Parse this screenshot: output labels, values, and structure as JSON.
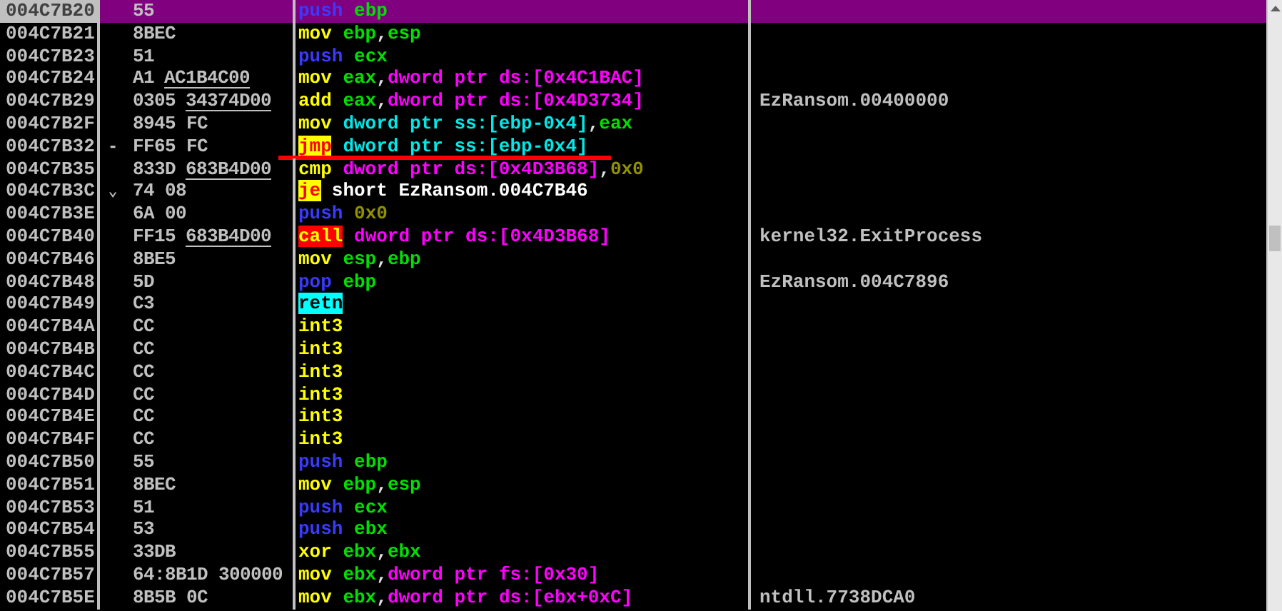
{
  "rows": [
    {
      "address": "004C7B20",
      "selected": true,
      "bytes": [
        {
          "text": "55",
          "fixup": false
        }
      ],
      "tokens": [
        {
          "text": "push",
          "kind": "push"
        },
        {
          "text": " ebp",
          "kind": "reg"
        }
      ],
      "comment": ""
    },
    {
      "address": "004C7B21",
      "selected": false,
      "bytes": [
        {
          "text": "8BEC",
          "fixup": false
        }
      ],
      "tokens": [
        {
          "text": "mov",
          "kind": "op"
        },
        {
          "text": " ebp",
          "kind": "reg"
        },
        {
          "text": ",",
          "kind": "punct"
        },
        {
          "text": "esp",
          "kind": "reg"
        }
      ]
    },
    {
      "address": "004C7B23",
      "selected": false,
      "bytes": [
        {
          "text": "51",
          "fixup": false
        }
      ],
      "tokens": [
        {
          "text": "push",
          "kind": "push"
        },
        {
          "text": " ecx",
          "kind": "reg"
        }
      ]
    },
    {
      "address": "004C7B24",
      "selected": false,
      "bytes": [
        {
          "text": "A1",
          "fixup": false
        },
        {
          "text": "AC1B4C00",
          "fixup": true
        }
      ],
      "tokens": [
        {
          "text": "mov",
          "kind": "op"
        },
        {
          "text": " eax",
          "kind": "reg"
        },
        {
          "text": ",",
          "kind": "punct"
        },
        {
          "text": "dword ptr ds:[0x4C1BAC]",
          "kind": "mem"
        }
      ]
    },
    {
      "address": "004C7B29",
      "selected": false,
      "bytes": [
        {
          "text": "0305",
          "fixup": false
        },
        {
          "text": "34374D00",
          "fixup": true
        }
      ],
      "tokens": [
        {
          "text": "add",
          "kind": "op"
        },
        {
          "text": " eax",
          "kind": "reg"
        },
        {
          "text": ",",
          "kind": "punct"
        },
        {
          "text": "dword ptr ds:[0x4D3734]",
          "kind": "mem"
        }
      ],
      "comment": "EzRansom.00400000"
    },
    {
      "address": "004C7B2F",
      "selected": false,
      "bytes": [
        {
          "text": "8945 FC",
          "fixup": false
        }
      ],
      "tokens": [
        {
          "text": "mov",
          "kind": "op"
        },
        {
          "text": " dword ptr ss:[ebp-0x4]",
          "kind": "stack"
        },
        {
          "text": ",",
          "kind": "punct"
        },
        {
          "text": "eax",
          "kind": "reg"
        }
      ]
    },
    {
      "address": "004C7B32",
      "selected": false,
      "jump_mark": "-",
      "marked": true,
      "bytes": [
        {
          "text": "FF65 FC",
          "fixup": false
        }
      ],
      "tokens": [
        {
          "text": "jmp",
          "kind": "jmp"
        },
        {
          "text": " dword ptr ss:[ebp-0x4]",
          "kind": "stack"
        }
      ]
    },
    {
      "address": "004C7B35",
      "selected": false,
      "bytes": [
        {
          "text": "833D",
          "fixup": false
        },
        {
          "text": "683B4D00",
          "fixup": true
        }
      ],
      "tokens": [
        {
          "text": "cmp",
          "kind": "op"
        },
        {
          "text": " dword ptr ds:[0x4D3B68]",
          "kind": "mem"
        },
        {
          "text": ",",
          "kind": "punct"
        },
        {
          "text": "0x0",
          "kind": "imm"
        }
      ]
    },
    {
      "address": "004C7B3C",
      "selected": false,
      "jump_mark": "⌄",
      "bytes": [
        {
          "text": "74 08",
          "fixup": false
        }
      ],
      "tokens": [
        {
          "text": "je",
          "kind": "jmp"
        },
        {
          "text": " short EzRansom.004C7B46",
          "kind": "plain"
        }
      ]
    },
    {
      "address": "004C7B3E",
      "selected": false,
      "bytes": [
        {
          "text": "6A 00",
          "fixup": false
        }
      ],
      "tokens": [
        {
          "text": "push",
          "kind": "push"
        },
        {
          "text": " 0x0",
          "kind": "imm"
        }
      ]
    },
    {
      "address": "004C7B40",
      "selected": false,
      "bytes": [
        {
          "text": "FF15",
          "fixup": false
        },
        {
          "text": "683B4D00",
          "fixup": true
        }
      ],
      "tokens": [
        {
          "text": "call",
          "kind": "call"
        },
        {
          "text": " dword ptr ds:[0x4D3B68]",
          "kind": "mem"
        }
      ],
      "comment": "kernel32.ExitProcess"
    },
    {
      "address": "004C7B46",
      "selected": false,
      "bytes": [
        {
          "text": "8BE5",
          "fixup": false
        }
      ],
      "tokens": [
        {
          "text": "mov",
          "kind": "op"
        },
        {
          "text": " esp",
          "kind": "reg"
        },
        {
          "text": ",",
          "kind": "punct"
        },
        {
          "text": "ebp",
          "kind": "reg"
        }
      ]
    },
    {
      "address": "004C7B48",
      "selected": false,
      "bytes": [
        {
          "text": "5D",
          "fixup": false
        }
      ],
      "tokens": [
        {
          "text": "pop",
          "kind": "push"
        },
        {
          "text": " ebp",
          "kind": "reg"
        }
      ],
      "comment": "EzRansom.004C7896"
    },
    {
      "address": "004C7B49",
      "selected": false,
      "bytes": [
        {
          "text": "C3",
          "fixup": false
        }
      ],
      "tokens": [
        {
          "text": "retn",
          "kind": "ret"
        }
      ]
    },
    {
      "address": "004C7B4A",
      "selected": false,
      "bytes": [
        {
          "text": "CC",
          "fixup": false
        }
      ],
      "tokens": [
        {
          "text": "int3",
          "kind": "op"
        }
      ]
    },
    {
      "address": "004C7B4B",
      "selected": false,
      "bytes": [
        {
          "text": "CC",
          "fixup": false
        }
      ],
      "tokens": [
        {
          "text": "int3",
          "kind": "op"
        }
      ]
    },
    {
      "address": "004C7B4C",
      "selected": false,
      "bytes": [
        {
          "text": "CC",
          "fixup": false
        }
      ],
      "tokens": [
        {
          "text": "int3",
          "kind": "op"
        }
      ]
    },
    {
      "address": "004C7B4D",
      "selected": false,
      "bytes": [
        {
          "text": "CC",
          "fixup": false
        }
      ],
      "tokens": [
        {
          "text": "int3",
          "kind": "op"
        }
      ]
    },
    {
      "address": "004C7B4E",
      "selected": false,
      "bytes": [
        {
          "text": "CC",
          "fixup": false
        }
      ],
      "tokens": [
        {
          "text": "int3",
          "kind": "op"
        }
      ]
    },
    {
      "address": "004C7B4F",
      "selected": false,
      "bytes": [
        {
          "text": "CC",
          "fixup": false
        }
      ],
      "tokens": [
        {
          "text": "int3",
          "kind": "op"
        }
      ]
    },
    {
      "address": "004C7B50",
      "selected": false,
      "bytes": [
        {
          "text": "55",
          "fixup": false
        }
      ],
      "tokens": [
        {
          "text": "push",
          "kind": "push"
        },
        {
          "text": " ebp",
          "kind": "reg"
        }
      ]
    },
    {
      "address": "004C7B51",
      "selected": false,
      "bytes": [
        {
          "text": "8BEC",
          "fixup": false
        }
      ],
      "tokens": [
        {
          "text": "mov",
          "kind": "op"
        },
        {
          "text": " ebp",
          "kind": "reg"
        },
        {
          "text": ",",
          "kind": "punct"
        },
        {
          "text": "esp",
          "kind": "reg"
        }
      ]
    },
    {
      "address": "004C7B53",
      "selected": false,
      "bytes": [
        {
          "text": "51",
          "fixup": false
        }
      ],
      "tokens": [
        {
          "text": "push",
          "kind": "push"
        },
        {
          "text": " ecx",
          "kind": "reg"
        }
      ]
    },
    {
      "address": "004C7B54",
      "selected": false,
      "bytes": [
        {
          "text": "53",
          "fixup": false
        }
      ],
      "tokens": [
        {
          "text": "push",
          "kind": "push"
        },
        {
          "text": " ebx",
          "kind": "reg"
        }
      ]
    },
    {
      "address": "004C7B55",
      "selected": false,
      "bytes": [
        {
          "text": "33DB",
          "fixup": false
        }
      ],
      "tokens": [
        {
          "text": "xor",
          "kind": "op"
        },
        {
          "text": " ebx",
          "kind": "reg"
        },
        {
          "text": ",",
          "kind": "punct"
        },
        {
          "text": "ebx",
          "kind": "reg"
        }
      ]
    },
    {
      "address": "004C7B57",
      "selected": false,
      "bytes": [
        {
          "text": "64:8B1D 300000",
          "fixup": false
        }
      ],
      "tokens": [
        {
          "text": "mov",
          "kind": "op"
        },
        {
          "text": " ebx",
          "kind": "reg"
        },
        {
          "text": ",",
          "kind": "punct"
        },
        {
          "text": "dword ptr fs:[0x30]",
          "kind": "mem"
        }
      ]
    },
    {
      "address": "004C7B5E",
      "selected": false,
      "bytes": [
        {
          "text": "8B5B 0C",
          "fixup": false
        }
      ],
      "tokens": [
        {
          "text": "mov",
          "kind": "op"
        },
        {
          "text": " ebx",
          "kind": "reg"
        },
        {
          "text": ",",
          "kind": "punct"
        },
        {
          "text": "dword ptr ds:[ebx+0xC]",
          "kind": "mem"
        }
      ],
      "comment": "ntdll.7738DCA0"
    }
  ]
}
